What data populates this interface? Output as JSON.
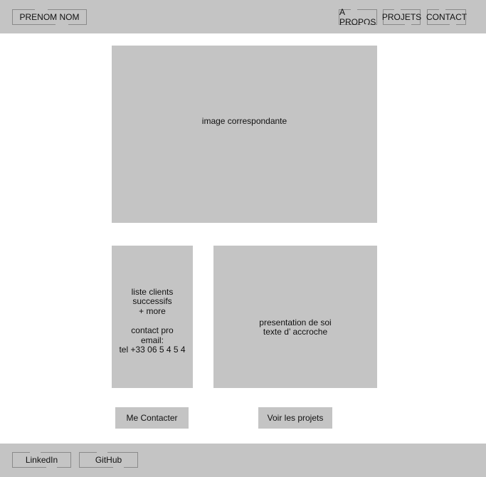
{
  "header": {
    "brand": "PRENOM NOM",
    "nav": [
      "A PROPOS",
      "PROJETS",
      "CONTACT"
    ]
  },
  "hero": {
    "image_label": "image correspondante"
  },
  "clients_panel": {
    "lines": [
      "liste clients",
      "successifs",
      "+ more",
      "",
      "contact pro",
      "email:",
      "tel +33 06 5 4 5 4"
    ]
  },
  "intro_panel": {
    "lines": [
      "presentation de soi",
      "texte d’ accroche"
    ]
  },
  "actions": {
    "contact_label": "Me Contacter",
    "projects_label": "Voir les projets"
  },
  "footer": {
    "links": [
      "LinkedIn",
      "GitHub"
    ]
  },
  "colors": {
    "placeholder_gray": "#c4c4c4",
    "background": "#ffffff"
  }
}
